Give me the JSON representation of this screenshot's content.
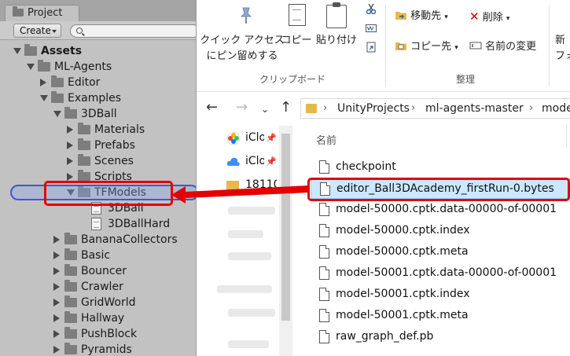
{
  "unity": {
    "tab_label": "Project",
    "create_label": "Create",
    "tree": [
      {
        "label": "Assets",
        "bold": true,
        "arrow": "down",
        "kind": "folder",
        "indent": 0
      },
      {
        "label": "ML-Agents",
        "arrow": "down",
        "kind": "folder",
        "indent": 1
      },
      {
        "label": "Editor",
        "arrow": "right",
        "kind": "folder",
        "indent": 2
      },
      {
        "label": "Examples",
        "arrow": "down",
        "kind": "folder",
        "indent": 2
      },
      {
        "label": "3DBall",
        "arrow": "down",
        "kind": "folder",
        "indent": 3
      },
      {
        "label": "Materials",
        "arrow": "right",
        "kind": "folder",
        "indent": 4
      },
      {
        "label": "Prefabs",
        "arrow": "right",
        "kind": "folder",
        "indent": 4
      },
      {
        "label": "Scenes",
        "arrow": "right",
        "kind": "folder",
        "indent": 4
      },
      {
        "label": "Scripts",
        "arrow": "right",
        "kind": "folder",
        "indent": 4
      },
      {
        "label": "TFModels",
        "arrow": "down",
        "kind": "folder",
        "indent": 4
      },
      {
        "label": "3DBall",
        "arrow": "",
        "kind": "file",
        "indent": 5
      },
      {
        "label": "3DBallHard",
        "arrow": "",
        "kind": "file",
        "indent": 5
      },
      {
        "label": "BananaCollectors",
        "arrow": "right",
        "kind": "folder",
        "indent": 3
      },
      {
        "label": "Basic",
        "arrow": "right",
        "kind": "folder",
        "indent": 3
      },
      {
        "label": "Bouncer",
        "arrow": "right",
        "kind": "folder",
        "indent": 3
      },
      {
        "label": "Crawler",
        "arrow": "right",
        "kind": "folder",
        "indent": 3
      },
      {
        "label": "GridWorld",
        "arrow": "right",
        "kind": "folder",
        "indent": 3
      },
      {
        "label": "Hallway",
        "arrow": "right",
        "kind": "folder",
        "indent": 3
      },
      {
        "label": "PushBlock",
        "arrow": "right",
        "kind": "folder",
        "indent": 3
      },
      {
        "label": "Pyramids",
        "arrow": "right",
        "kind": "folder",
        "indent": 3
      }
    ]
  },
  "ribbon": {
    "pin_line1": "クイック アクセス",
    "pin_line2": "にピン留めする",
    "copy": "コピー",
    "paste": "貼り付け",
    "group_clipboard": "クリップボード",
    "move_to": "移動先",
    "delete": "削除",
    "copy_to": "コピー先",
    "rename": "名前の変更",
    "group_organize": "整理",
    "new_line1": "新",
    "new_line2": "フォ"
  },
  "address": {
    "crumbs": [
      "UnityProjects",
      "ml-agents-master",
      "mode"
    ]
  },
  "nav": {
    "items": [
      "iClo",
      "iClo",
      "18110"
    ]
  },
  "files": {
    "header": "名前",
    "items": [
      "checkpoint",
      "editor_Ball3DAcademy_firstRun-0.bytes",
      "model-50000.cptk.data-00000-of-00001",
      "model-50000.cptk.index",
      "model-50000.cptk.meta",
      "model-50001.cptk.data-00000-of-00001",
      "model-50001.cptk.index",
      "model-50001.cptk.meta",
      "raw_graph_def.pb"
    ],
    "selected_index": 1
  },
  "colors": {
    "annotation_red": "#e30000",
    "unity_bg": "#c2c2c2",
    "selection_blue": "#cce8ff"
  }
}
